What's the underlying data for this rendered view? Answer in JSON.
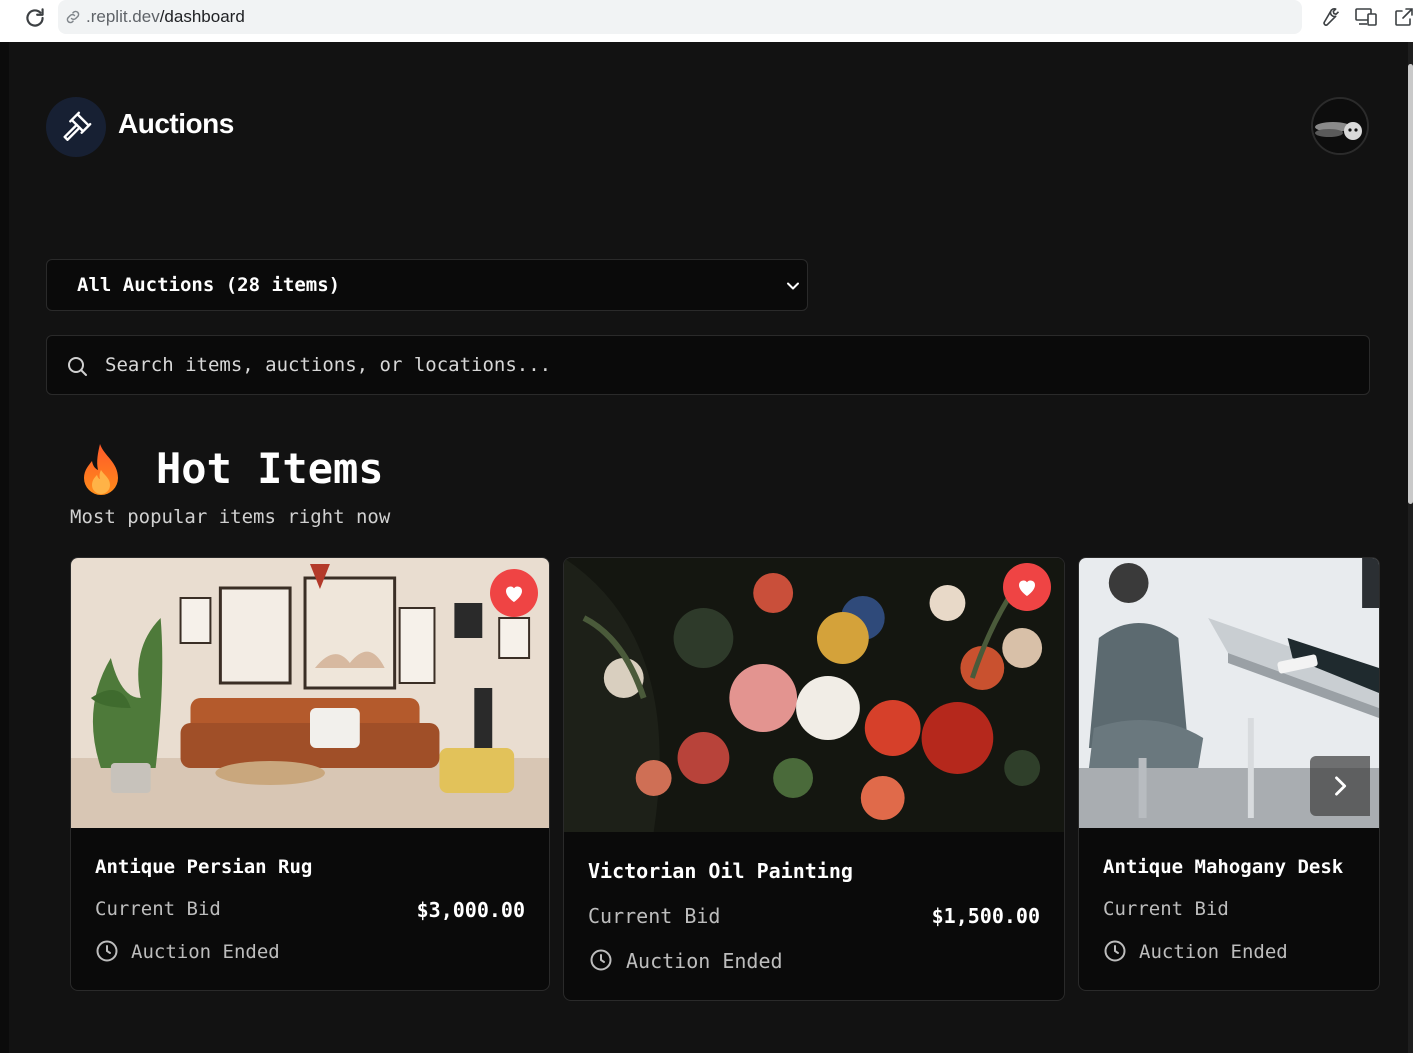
{
  "browser": {
    "url_prefix": ".replit.dev",
    "url_path": "/dashboard"
  },
  "app": {
    "brand": "Auctions",
    "icons": {
      "logo": "gavel-icon",
      "avatar": "user-avatar"
    }
  },
  "filter": {
    "selected": "All Auctions (28 items)"
  },
  "search": {
    "placeholder": "Search items, auctions, or locations..."
  },
  "hot": {
    "title": "Hot Items",
    "subtitle": "Most popular items right now",
    "icon": "fire-icon"
  },
  "cards": [
    {
      "name": "Antique Persian Rug",
      "bid_label": "Current Bid",
      "price": "$3,000.00",
      "status": "Auction Ended",
      "favorited": true
    },
    {
      "name": "Victorian Oil Painting",
      "bid_label": "Current Bid",
      "price": "$1,500.00",
      "status": "Auction Ended",
      "favorited": true
    },
    {
      "name": "Antique Mahogany Desk",
      "bid_label": "Current Bid",
      "price": "",
      "status": "Auction Ended",
      "favorited": false
    }
  ],
  "colors": {
    "background": "#121212",
    "card": "#0a0a0a",
    "accent_heart": "#ef4444",
    "logo_bg": "#172033"
  }
}
